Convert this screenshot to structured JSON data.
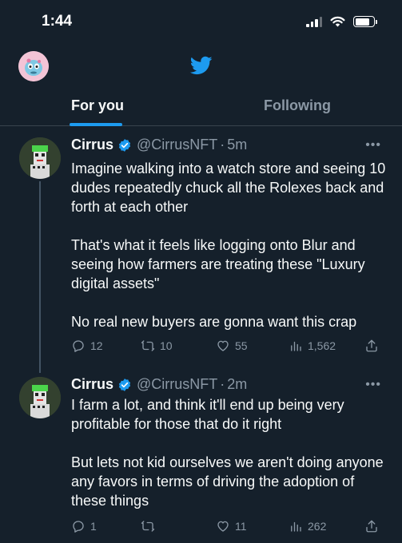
{
  "status_bar": {
    "time": "1:44"
  },
  "tabs": [
    {
      "label": "For you",
      "selected": true
    },
    {
      "label": "Following",
      "selected": false
    }
  ],
  "colors": {
    "background": "#15202b",
    "accent": "#1d9bf0",
    "muted": "#8b98a5",
    "divider": "#38444d"
  },
  "tweets": [
    {
      "name": "Cirrus",
      "verified": true,
      "handle": "@CirrusNFT",
      "separator": "·",
      "time": "5m",
      "more": "•••",
      "paragraphs": [
        "Imagine walking into a watch store and seeing 10 dudes repeatedly chuck all the Rolexes back and forth at each other",
        "That's what it feels like logging onto Blur and seeing how farmers are treating these \"Luxury digital assets\"",
        "No real new buyers are gonna want this crap"
      ],
      "replies": "12",
      "retweets": "10",
      "likes": "55",
      "views": "1,562"
    },
    {
      "name": "Cirrus",
      "verified": true,
      "handle": "@CirrusNFT",
      "separator": "·",
      "time": "2m",
      "more": "•••",
      "paragraphs": [
        "I farm a lot, and think it'll end up being very profitable for those that do it right",
        "But lets not kid ourselves we aren't doing anyone any favors in terms of driving the adoption of these things"
      ],
      "replies": "1",
      "retweets": "",
      "likes": "11",
      "views": "262"
    }
  ],
  "icons": [
    "signal-icon",
    "wifi-icon",
    "battery-icon",
    "twitter-bird-icon",
    "verified-badge-icon",
    "reply-icon",
    "retweet-icon",
    "like-icon",
    "views-icon",
    "share-icon"
  ]
}
